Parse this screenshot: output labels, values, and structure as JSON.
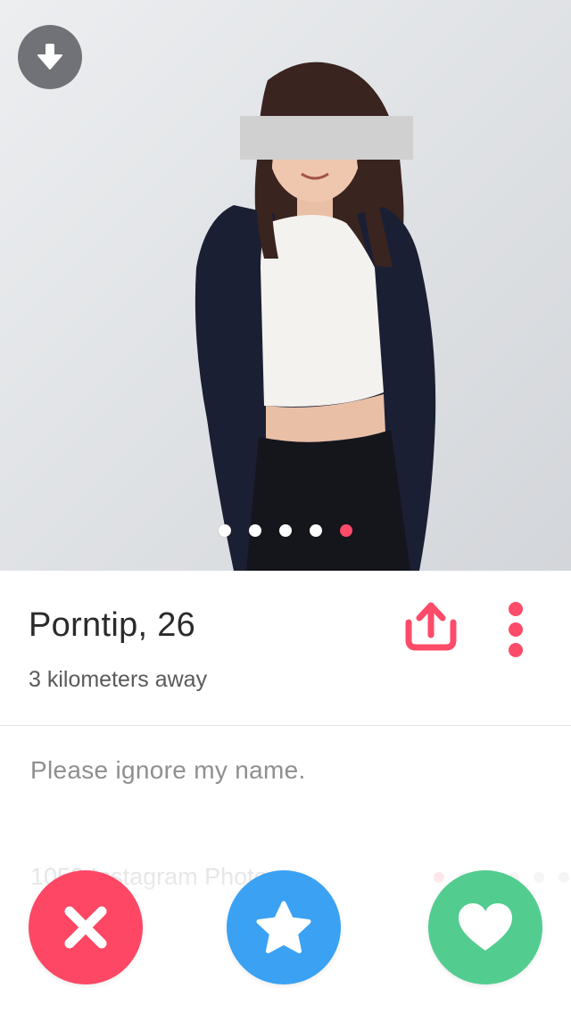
{
  "profile": {
    "name_age": "Porntip, 26",
    "distance": "3 kilometers away",
    "bio": "Please ignore my name.",
    "instagram_title": "1052 Instagram Photos"
  },
  "photo_carousel": {
    "total": 5,
    "active_index": 4
  },
  "icons": {
    "collapse": "arrow-down-icon",
    "share": "share-icon",
    "more": "more-vertical-icon",
    "nope": "close-icon",
    "super_like": "star-icon",
    "like": "heart-icon"
  },
  "colors": {
    "accent": "#fd4b6a",
    "nope": "#fd4765",
    "super_like": "#3aa1f3",
    "like": "#52cd8f",
    "collapse_bg": "#5a5d61"
  }
}
